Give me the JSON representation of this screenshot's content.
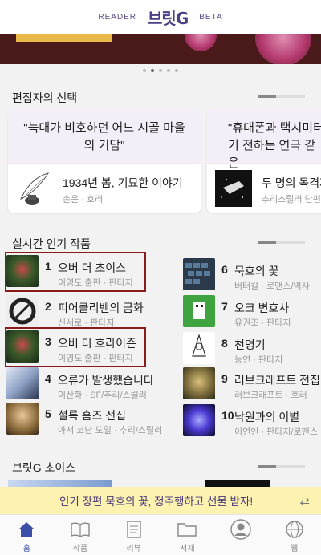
{
  "header": {
    "left": "READER",
    "logo": "브릿G",
    "right": "BETA"
  },
  "carousel": {
    "dots": 5,
    "active": 1
  },
  "editors_pick": {
    "heading": "편집자의 선택",
    "cards": [
      {
        "quote": "\"늑대가 비호하던 어느 시골 마을의 기담\"",
        "title": "1934년 봄, 기묘한 이야기",
        "meta": "손운 · 호러"
      },
      {
        "quote": "\"휴대폰과 택시미터기 전하는 연극 같은",
        "title": "두 명의 목격자",
        "meta": "추리스릴러 단편"
      }
    ]
  },
  "popular": {
    "heading": "실시간 인기 작품",
    "items": [
      {
        "rank": "1",
        "title": "오버 더 초이스",
        "meta": "이영도 출판 · 판타지"
      },
      {
        "rank": "2",
        "title": "피어클리벤의 금화",
        "meta": "신서로 · 판타지"
      },
      {
        "rank": "3",
        "title": "오버 더 호라이즌",
        "meta": "이영도 출판 · 판타지"
      },
      {
        "rank": "4",
        "title": "오류가 발생했습니다",
        "meta": "이산화 · SF/추리/스릴러"
      },
      {
        "rank": "5",
        "title": "셜록 홈즈 전집",
        "meta": "아서 코난 도일 · 추리/스릴러"
      },
      {
        "rank": "6",
        "title": "묵호의 꽃",
        "meta": "버터칼 · 로맨스/역사"
      },
      {
        "rank": "7",
        "title": "오크 변호사",
        "meta": "유권조 · 판타지"
      },
      {
        "rank": "8",
        "title": "천명기",
        "meta": "능연 · 판타지"
      },
      {
        "rank": "9",
        "title": "러브크래프트 전집",
        "meta": "러브크래프트 · 호러"
      },
      {
        "rank": "10",
        "title": "낙원과의 이별",
        "meta": "이연인 · 판타지/로맨스"
      }
    ]
  },
  "choice": {
    "heading": "브릿G 초이스"
  },
  "banner": {
    "text": "인기 장편 묵호의 꽃, 정주행하고 선물 받자!"
  },
  "tabbar": {
    "tabs": [
      {
        "label": "홈",
        "icon": "home-icon"
      },
      {
        "label": "작품",
        "icon": "book-icon"
      },
      {
        "label": "리뷰",
        "icon": "review-icon"
      },
      {
        "label": "서재",
        "icon": "folder-icon"
      },
      {
        "label": "",
        "icon": "profile-icon"
      },
      {
        "label": "웹",
        "icon": "globe-icon"
      }
    ],
    "active": "홈"
  },
  "colors": {
    "accent": "#4b3f86",
    "highlight": "#8b1a1a",
    "banner_bg": "#fdf2b0",
    "tab_active": "#3b4fa8"
  }
}
